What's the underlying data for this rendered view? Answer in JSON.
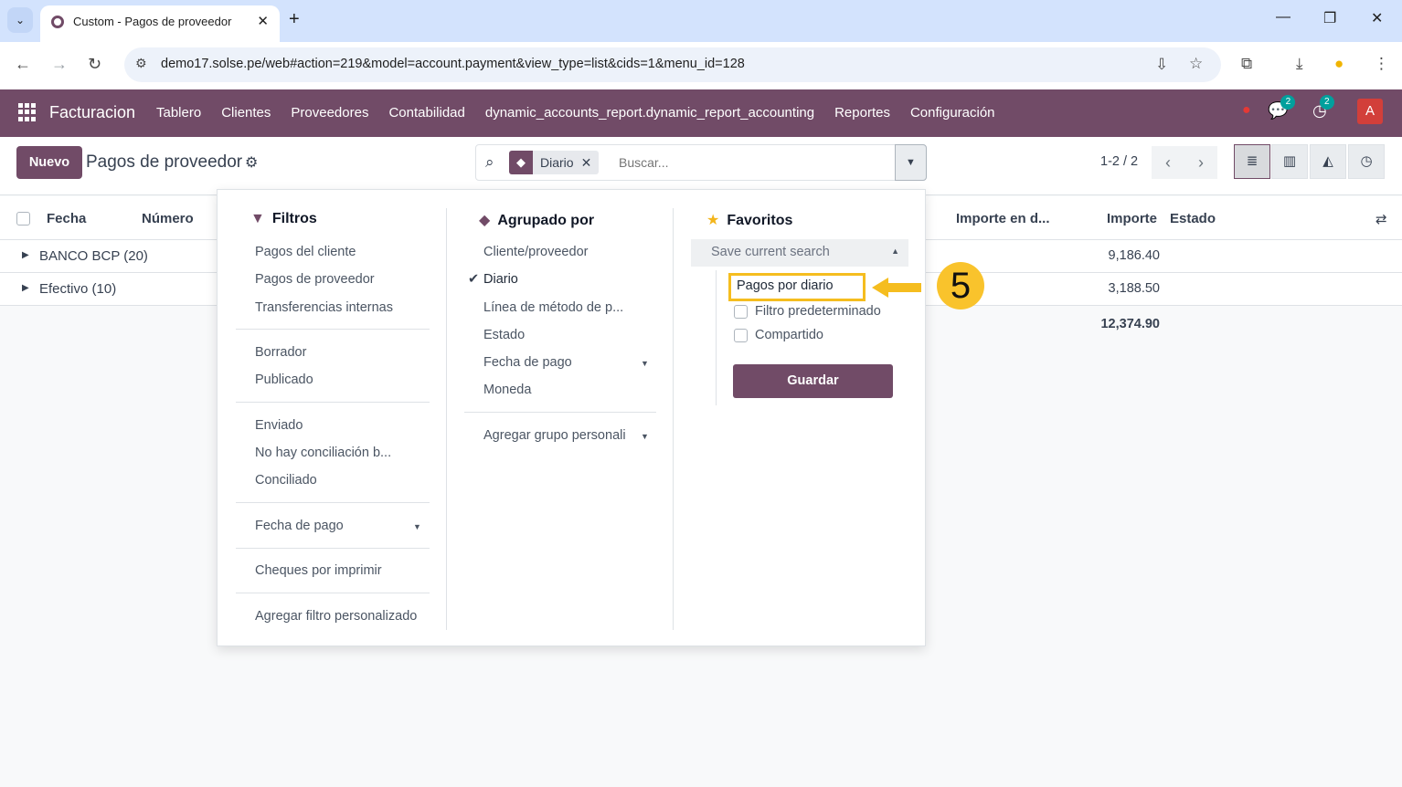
{
  "browser": {
    "tab_title": "Custom - Pagos de proveedor",
    "url": "demo17.solse.pe/web#action=219&model=account.payment&view_type=list&cids=1&menu_id=128"
  },
  "topnav": {
    "brand": "Facturacion",
    "menu": [
      "Tablero",
      "Clientes",
      "Proveedores",
      "Contabilidad",
      "dynamic_accounts_report.dynamic_report_accounting",
      "Reportes",
      "Configuración"
    ],
    "messages_badge": "2",
    "activities_badge": "2",
    "avatar": "A"
  },
  "control_panel": {
    "new_label": "Nuevo",
    "breadcrumb": "Pagos de proveedor",
    "facet_label": "Diario",
    "search_placeholder": "Buscar...",
    "pager": "1-2 / 2"
  },
  "list": {
    "headers": {
      "fecha": "Fecha",
      "numero": "Número",
      "importe_div": "Importe en d...",
      "importe": "Importe",
      "estado": "Estado"
    },
    "groups": [
      {
        "name": "BANCO BCP (20)",
        "amount": "9,186.40"
      },
      {
        "name": "Efectivo (10)",
        "amount": "3,188.50"
      }
    ],
    "total": "12,374.90"
  },
  "dropdown": {
    "filters": {
      "title": "Filtros",
      "group1": [
        "Pagos del cliente",
        "Pagos de proveedor",
        "Transferencias internas"
      ],
      "group2": [
        "Borrador",
        "Publicado"
      ],
      "group3": [
        "Enviado",
        "No hay conciliación b...",
        "Conciliado"
      ],
      "date_filter": "Fecha de pago",
      "checks": "Cheques por imprimir",
      "custom": "Agregar filtro personalizado"
    },
    "groupby": {
      "title": "Agrupado por",
      "items": [
        "Cliente/proveedor",
        "Diario",
        "Línea de método de p...",
        "Estado",
        "Fecha de pago",
        "Moneda"
      ],
      "custom": "Agregar grupo personali"
    },
    "favorites": {
      "title": "Favoritos",
      "save_header": "Save current search",
      "name_value": "Pagos por diario",
      "default_label": "Filtro predeterminado",
      "shared_label": "Compartido",
      "save_button": "Guardar"
    }
  },
  "callout": {
    "step": "5"
  },
  "colors": {
    "primary": "#714b67",
    "highlight": "#f5bd1f"
  }
}
